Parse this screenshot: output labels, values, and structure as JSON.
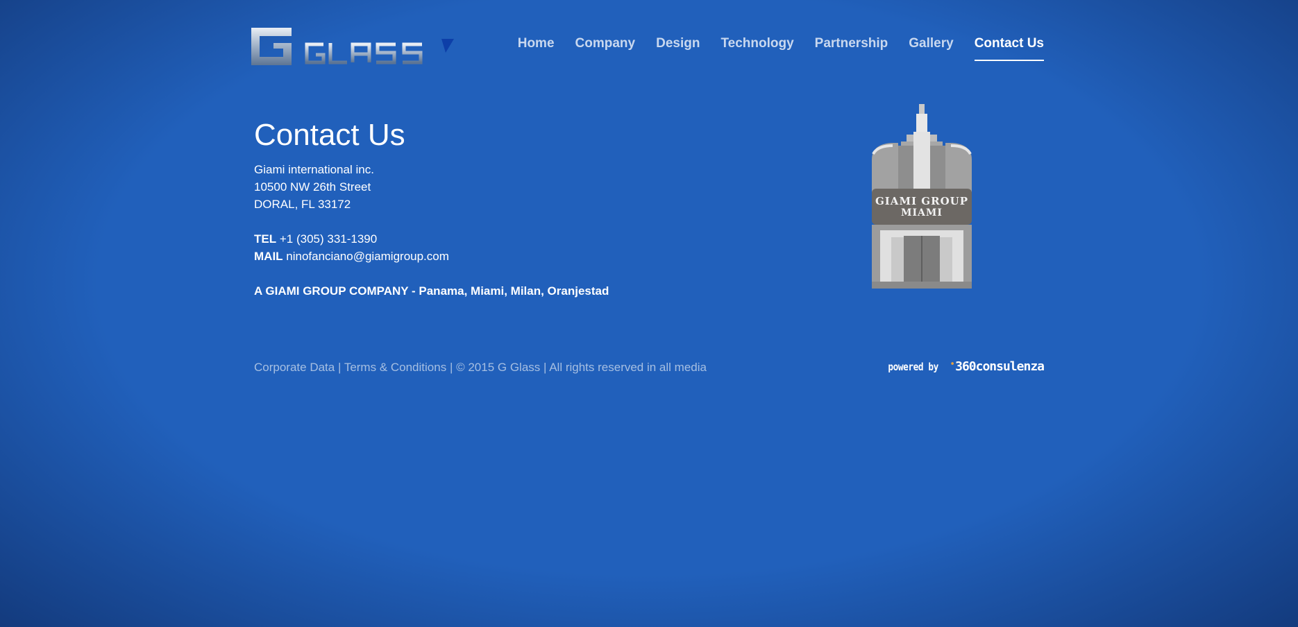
{
  "header": {
    "logo_text": "GGLASS",
    "nav": [
      {
        "label": "Home"
      },
      {
        "label": "Company"
      },
      {
        "label": "Design"
      },
      {
        "label": "Technology"
      },
      {
        "label": "Partnership"
      },
      {
        "label": "Gallery"
      },
      {
        "label": "Contact Us",
        "active": true
      }
    ]
  },
  "main": {
    "title": "Contact Us",
    "company": "Giami international inc.",
    "address1": "10500 NW 26th Street",
    "address2": "DORAL, FL 33172",
    "tel_label": "TEL",
    "tel_value": "+1 (305) 331-1390",
    "mail_label": "MAIL",
    "mail_value": "ninofanciano@giamigroup.com",
    "group_line": "A GIAMI GROUP COMPANY - Panama, Miami, Milan, Oranjestad",
    "building_sign_line1": "GIAMI GROUP",
    "building_sign_line2": "MIAMI"
  },
  "footer": {
    "corporate_data": "Corporate Data",
    "separator": "|",
    "terms": "Terms & Conditions",
    "copyright": "© 2015 G Glass | All rights reserved in all media",
    "powered_by": "powered by",
    "agency": "360consulenza"
  },
  "colors": {
    "background": "#2160bb",
    "text": "#ffffff",
    "nav_text": "#c9d8ef",
    "footer_text": "#a6bfe2"
  }
}
